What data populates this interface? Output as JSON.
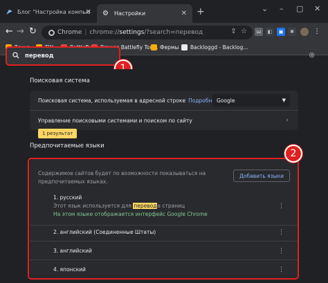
{
  "tabs": [
    {
      "title": "Блог \"Настройка компьютера\"",
      "active": false
    },
    {
      "title": "Настройки",
      "active": true
    }
  ],
  "window_controls": [
    "⌄",
    "–",
    "▢",
    "✕"
  ],
  "toolbar": {
    "omnibox_prefix": "Chrome",
    "omnibox_sep": "|",
    "url_base": "chrome://",
    "url_main": "settings",
    "url_rest": "/?search=перевод"
  },
  "bookmarks": [
    {
      "label": "Точка",
      "color": "#f9ab00"
    },
    {
      "label": "TW",
      "color": "#f9ab00"
    },
    {
      "label": "Battlefly",
      "color": "#e8453c"
    },
    {
      "label": "Browse Battlefly Tou...",
      "color": "#e8453c"
    },
    {
      "label": "Фермы",
      "color": "#f9ab00"
    },
    {
      "label": "Backloggd - Backlog...",
      "color": "#e8eaed"
    }
  ],
  "search": {
    "value": "перевод",
    "icon": "search-icon"
  },
  "badges": {
    "one": "1",
    "two": "2"
  },
  "search_engine": {
    "section_title": "Поисковая система",
    "row1_label": "Поисковая система, используемая в адресной строке",
    "row1_link": "Подробнее",
    "select_value": "Google",
    "row2_label": "Управление поисковыми системами и поиском по сайту"
  },
  "tooltip": "1 результат",
  "languages": {
    "section_title": "Предпочитаемые языки",
    "description": "Содержимое сайтов будет по возможности показываться на предпочитаемых языках.",
    "add_button": "Добавить языки",
    "item1_title": "1. русский",
    "item1_desc_pre": "Этот язык используется для ",
    "item1_desc_hl": "перевод",
    "item1_desc_post": "а страниц",
    "item1_note": "На этом языке отображается интерфейс Google Chrome",
    "item2": "2. английский (Соединенные Штаты)",
    "item3": "3. английский",
    "item4": "4. японский"
  },
  "colors": {
    "accent": "#8ab4f8",
    "highlight": "#fdd663",
    "annotation_red": "#e02020"
  }
}
